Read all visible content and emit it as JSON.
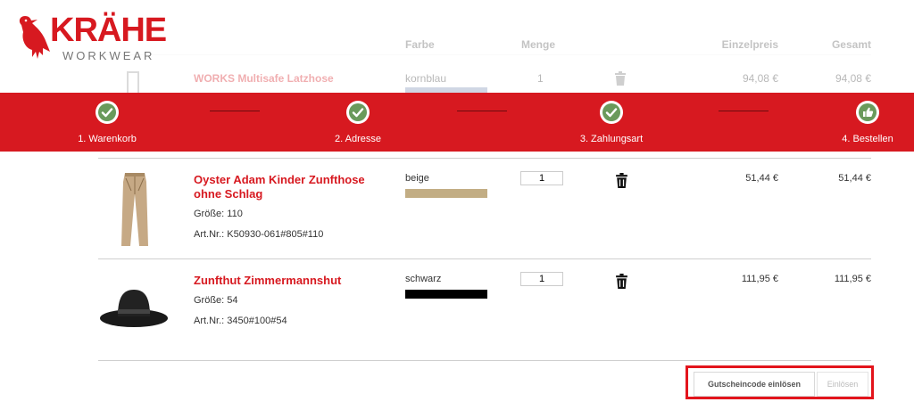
{
  "brand": {
    "name": "KRÄHE",
    "tagline": "WORKWEAR"
  },
  "table_header": {
    "color": "Farbe",
    "quantity": "Menge",
    "unit_price": "Einzelpreis",
    "total": "Gesamt"
  },
  "faded_item": {
    "name": "WORKS Multisafe Latzhose",
    "color_name": "kornblau",
    "quantity": "1",
    "unit_price": "94,08 €",
    "total": "94,08 €"
  },
  "steps": [
    {
      "label": "1. Warenkorb",
      "icon": "check-icon",
      "done": true
    },
    {
      "label": "2. Adresse",
      "icon": "check-icon",
      "done": true
    },
    {
      "label": "3. Zahlungsart",
      "icon": "check-icon",
      "done": true
    },
    {
      "label": "4. Bestellen",
      "icon": "thumbs-up-icon",
      "done": false
    }
  ],
  "items": [
    {
      "name": "Oyster Adam Kinder Zunfthose ohne Schlag",
      "size": "Größe: 110",
      "article": "Art.Nr.: K50930-061#805#110",
      "color_name": "beige",
      "color_hex": "#c2ad84",
      "quantity": "1",
      "unit_price": "51,44 €",
      "total": "51,44 €",
      "image": "trousers-image"
    },
    {
      "name": "Zunfthut Zimmermannshut",
      "size": "Größe: 54",
      "article": "Art.Nr.: 3450#100#54",
      "color_name": "schwarz",
      "color_hex": "#000000",
      "quantity": "1",
      "unit_price": "111,95 €",
      "total": "111,95 €",
      "image": "hat-image"
    }
  ],
  "voucher": {
    "button_label": "Gutscheincode einlösen",
    "redeem_label": "Einlösen"
  },
  "colors": {
    "brand_red": "#d71920",
    "progress_bg": "#d71920",
    "check_green": "#6a9a5b",
    "highlight": "#e3141c"
  }
}
